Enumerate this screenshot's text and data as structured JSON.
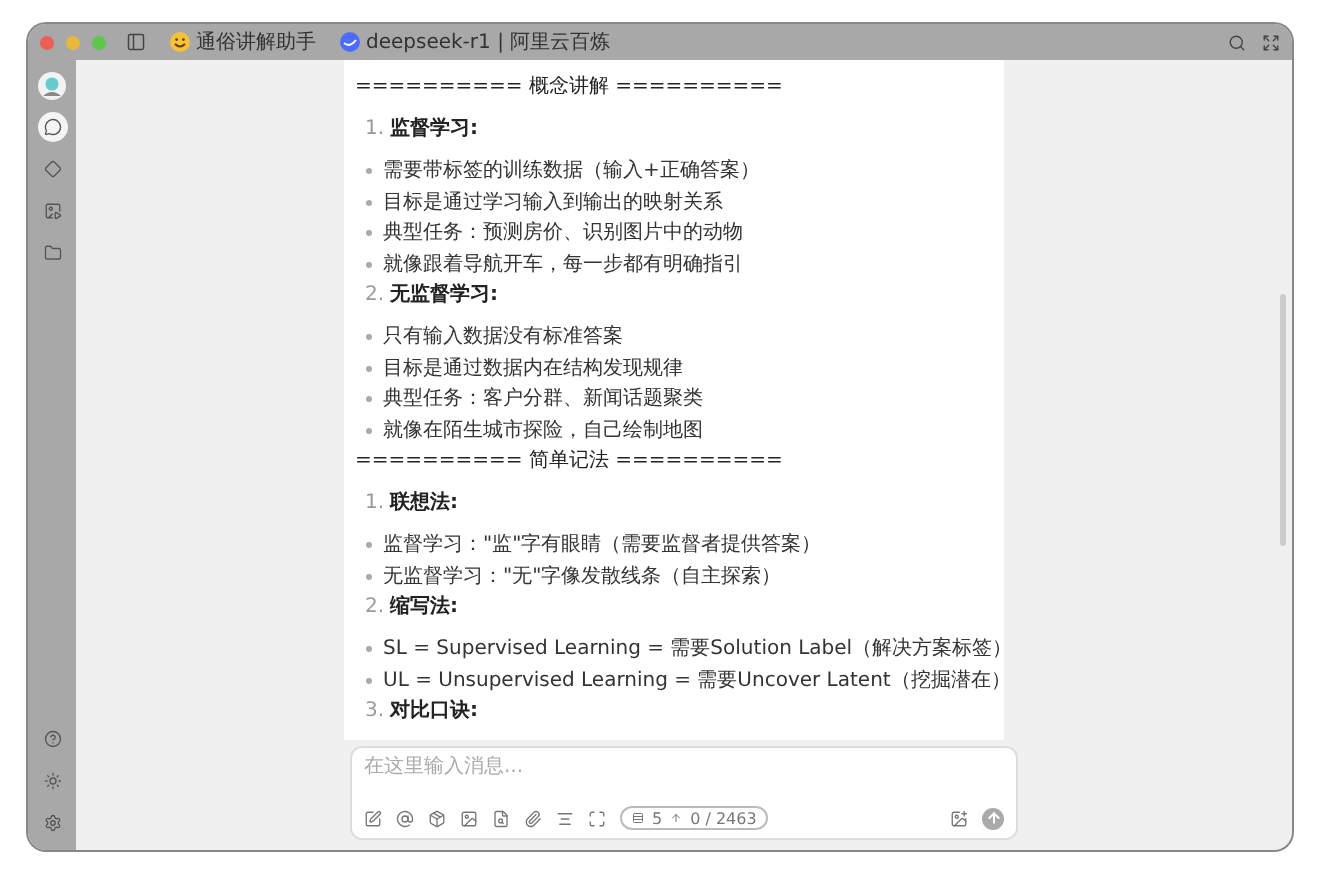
{
  "titlebar": {
    "tabs": [
      {
        "kind": "assistant",
        "label": "通俗讲解助手"
      },
      {
        "kind": "model",
        "label": "deepseek-r1 | 阿里云百炼"
      }
    ]
  },
  "sidebar": {
    "items": [
      {
        "kind": "chat",
        "selected": true
      },
      {
        "kind": "diamond",
        "selected": false
      },
      {
        "kind": "image",
        "selected": false
      },
      {
        "kind": "folder",
        "selected": false
      }
    ],
    "bottom": [
      {
        "kind": "help"
      },
      {
        "kind": "theme"
      },
      {
        "kind": "settings"
      }
    ]
  },
  "message": {
    "blocks": [
      {
        "kind": "rule",
        "text": "========== 概念讲解 =========="
      },
      {
        "kind": "numbered",
        "number": "1.",
        "text": "监督学习:"
      },
      {
        "kind": "bullet",
        "text": "需要带标签的训练数据（输入+正确答案）"
      },
      {
        "kind": "bullet",
        "text": "目标是通过学习输入到输出的映射关系"
      },
      {
        "kind": "bullet",
        "text": "典型任务：预测房价、识别图片中的动物"
      },
      {
        "kind": "bullet",
        "text": "就像跟着导航开车，每一步都有明确指引"
      },
      {
        "kind": "numbered",
        "number": "2.",
        "text": "无监督学习:"
      },
      {
        "kind": "bullet",
        "text": "只有输入数据没有标准答案"
      },
      {
        "kind": "bullet",
        "text": "目标是通过数据内在结构发现规律"
      },
      {
        "kind": "bullet",
        "text": "典型任务：客户分群、新闻话题聚类"
      },
      {
        "kind": "bullet",
        "text": "就像在陌生城市探险，自己绘制地图"
      },
      {
        "kind": "rule",
        "text": "========== 简单记法 =========="
      },
      {
        "kind": "numbered",
        "number": "1.",
        "text": "联想法:"
      },
      {
        "kind": "bullet",
        "text": "监督学习：\"监\"字有眼睛（需要监督者提供答案）"
      },
      {
        "kind": "bullet",
        "text": "无监督学习：\"无\"字像发散线条（自主探索）"
      },
      {
        "kind": "numbered",
        "number": "2.",
        "text": "缩写法:"
      },
      {
        "kind": "bullet",
        "text": "SL = Supervised Learning = 需要Solution Label（解决方案标签）"
      },
      {
        "kind": "bullet",
        "text": "UL = Unsupervised Learning = 需要Uncover Latent（挖掘潜在）"
      },
      {
        "kind": "numbered",
        "number": "3.",
        "text": "对比口诀:"
      }
    ]
  },
  "composer": {
    "placeholder": "在这里输入消息...",
    "context_count": "5",
    "token_count": "0 / 2463"
  }
}
